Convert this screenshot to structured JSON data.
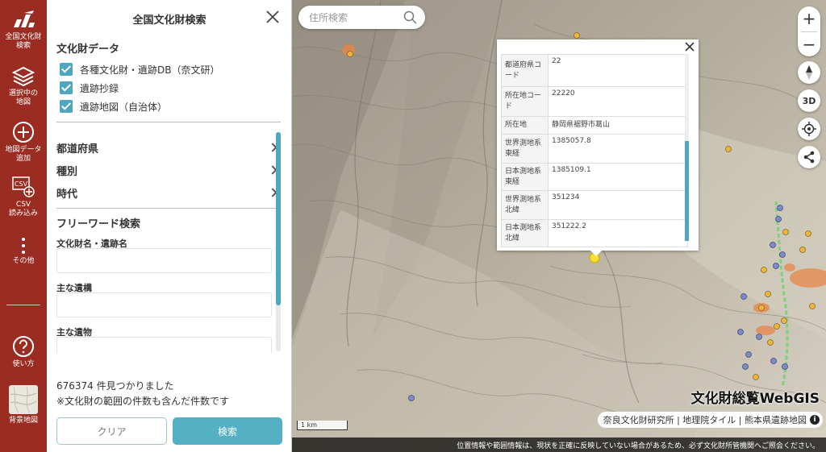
{
  "rail": {
    "items": [
      {
        "label_line1": "全国文化財",
        "label_line2": "検索",
        "icon": "logo-icon"
      },
      {
        "label_line1": "選択中の",
        "label_line2": "地図",
        "icon": "layers-icon"
      },
      {
        "label_line1": "地図データ",
        "label_line2": "追加",
        "icon": "plus-circle-icon"
      },
      {
        "label_line1": "CSV",
        "label_line2": "読み込み",
        "icon": "csv-icon"
      },
      {
        "label_line1": "その他",
        "label_line2": "",
        "icon": "more-vertical-icon"
      },
      {
        "label_line1": "使い方",
        "label_line2": "",
        "icon": "help-icon"
      },
      {
        "label_line1": "背景地図",
        "label_line2": "",
        "icon": "basemap-thumbnail-icon"
      }
    ],
    "csv_icon_text": "CSV"
  },
  "panel": {
    "title": "全国文化財検索",
    "data_section": "文化財データ",
    "checkboxes": [
      {
        "label": "各種文化財・遺跡DB（奈文研）",
        "checked": true
      },
      {
        "label": "遺跡抄録",
        "checked": true
      },
      {
        "label": "遺跡地図（自治体）",
        "checked": true
      }
    ],
    "nav": [
      {
        "label": "都道府県"
      },
      {
        "label": "種別"
      },
      {
        "label": "時代"
      }
    ],
    "freeword_section": "フリーワード検索",
    "fields": [
      {
        "label": "文化財名・遺跡名",
        "value": ""
      },
      {
        "label": "主な遺構",
        "value": ""
      },
      {
        "label": "主な遺物",
        "value": ""
      }
    ],
    "result_count": "676374 件見つかりました",
    "result_note": "※文化財の範囲の件数も含んだ件数です",
    "clear_label": "クリア",
    "search_label": "検索"
  },
  "map": {
    "address_search_placeholder": "住所検索",
    "zoom_in": "+",
    "zoom_out": "−",
    "three_d_label": "3D",
    "popup": {
      "rows": [
        {
          "key": "都道府県コード",
          "value": "22"
        },
        {
          "key": "所在地コード",
          "value": "22220"
        },
        {
          "key": "所在地",
          "value": "静岡県裾野市葛山"
        },
        {
          "key": "世界測地系東経",
          "value": "1385057.8"
        },
        {
          "key": "日本測地系東経",
          "value": "1385109.1"
        },
        {
          "key": "世界測地系北緯",
          "value": "351234"
        },
        {
          "key": "日本測地系北緯",
          "value": "351222.2"
        }
      ]
    },
    "brand": "文化財総覧WebGIS",
    "attribution": "奈良文化財研究所 | 地理院タイル | 熊本県遺跡地図",
    "info_symbol": "i",
    "scale": "1 km",
    "disclaimer": "位置情報や範囲情報は、現状を正確に反映していない場合があるため、必ず文化財所管機関へご照会ください。",
    "colors": {
      "point_yellow": "#f2b535",
      "point_blue": "#7f8cc4",
      "range_orange": "#e8864a",
      "trail_green": "#7fcf7f"
    }
  }
}
